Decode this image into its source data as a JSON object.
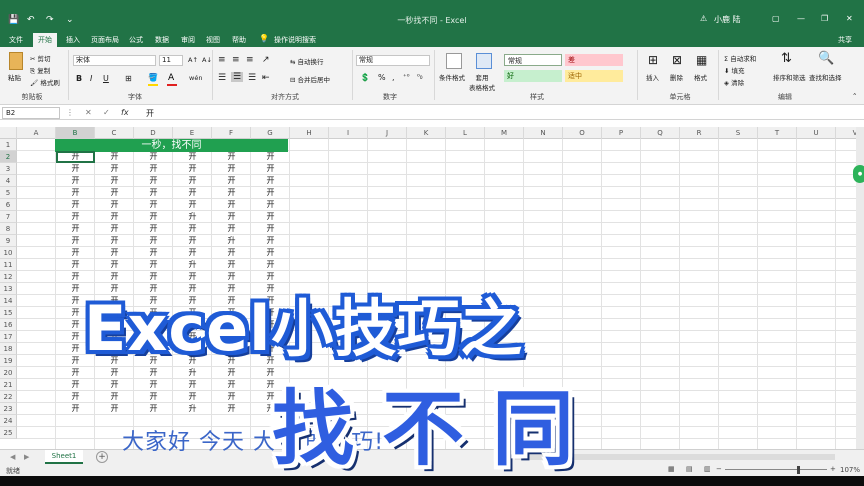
{
  "window": {
    "title": "一秒找不同 - Excel",
    "user": "小鹿 陆",
    "controls": [
      "⚠",
      "▢",
      "—",
      "❐",
      "✕"
    ]
  },
  "quick_access": [
    "💾",
    "↶",
    "↷",
    "⌄"
  ],
  "tabs": [
    "文件",
    "开始",
    "插入",
    "页面布局",
    "公式",
    "数据",
    "审阅",
    "视图",
    "帮助"
  ],
  "tell_me": "操作说明搜索",
  "share": "共享",
  "ribbon": {
    "clipboard": {
      "paste": "粘贴",
      "cut": "剪切",
      "copy": "复制",
      "format_painter": "格式刷",
      "label": "剪贴板"
    },
    "font": {
      "name": "宋体",
      "size": "11",
      "bold": "B",
      "italic": "I",
      "underline": "U",
      "grow": "A↑",
      "shrink": "A↓",
      "wen": "wén",
      "label": "字体"
    },
    "alignment": {
      "wrap": "自动换行",
      "merge": "合并后居中",
      "label": "对齐方式"
    },
    "number": {
      "format": "常规",
      "percent": "%",
      "comma": ",",
      "label": "数字"
    },
    "styles": {
      "cond": "条件格式",
      "table": "套用\n表格格式",
      "cells": [
        {
          "text": "常规",
          "bg": "#ffffff",
          "fg": "#222222"
        },
        {
          "text": "差",
          "bg": "#ffc7ce",
          "fg": "#9c0006"
        },
        {
          "text": "好",
          "bg": "#c6efce",
          "fg": "#006100"
        },
        {
          "text": "适中",
          "bg": "#ffeb9c",
          "fg": "#9c6500"
        }
      ],
      "label": "样式"
    },
    "cells": {
      "insert": "插入",
      "delete": "删除",
      "format": "格式",
      "label": "单元格"
    },
    "editing": {
      "autosum": "自动求和",
      "fill": "填充",
      "clear": "清除",
      "sort": "排序和筛选",
      "find": "查找和选择",
      "label": "编辑"
    }
  },
  "formula_bar": {
    "name_box": "B2",
    "fx": "fx",
    "value": "开"
  },
  "columns": [
    "A",
    "B",
    "C",
    "D",
    "E",
    "F",
    "G",
    "H",
    "I",
    "J",
    "K",
    "L",
    "M",
    "N",
    "O",
    "P",
    "Q",
    "R",
    "S",
    "T",
    "U",
    "V"
  ],
  "rows": [
    "1",
    "2",
    "3",
    "4",
    "5",
    "6",
    "7",
    "8",
    "9",
    "10",
    "11",
    "12",
    "13",
    "14",
    "15",
    "16",
    "17",
    "18",
    "19",
    "20",
    "21",
    "22",
    "23",
    "24",
    "25"
  ],
  "selected_col": "B",
  "selected_row": "2",
  "merged_title": "一秒，找不同",
  "grid_rows": [
    [
      "开",
      "开",
      "开",
      "开",
      "开",
      "开"
    ],
    [
      "开",
      "开",
      "开",
      "开",
      "开",
      "开"
    ],
    [
      "开",
      "开",
      "开",
      "开",
      "开",
      "开"
    ],
    [
      "开",
      "开",
      "开",
      "开",
      "开",
      "开"
    ],
    [
      "开",
      "开",
      "开",
      "开",
      "开",
      "开"
    ],
    [
      "开",
      "开",
      "开",
      "升",
      "开",
      "开"
    ],
    [
      "开",
      "开",
      "开",
      "开",
      "开",
      "开"
    ],
    [
      "开",
      "开",
      "开",
      "开",
      "升",
      "开"
    ],
    [
      "开",
      "开",
      "开",
      "开",
      "开",
      "开"
    ],
    [
      "开",
      "开",
      "开",
      "升",
      "开",
      "开"
    ],
    [
      "开",
      "开",
      "开",
      "开",
      "开",
      "开"
    ],
    [
      "开",
      "开",
      "开",
      "开",
      "开",
      "开"
    ],
    [
      "开",
      "开",
      "开",
      "开",
      "开",
      "开"
    ],
    [
      "开",
      "开",
      "开",
      "开",
      "开",
      "开"
    ],
    [
      "开",
      "开",
      "开",
      "开",
      "开",
      "开"
    ],
    [
      "开",
      "开",
      "开",
      "开",
      "开",
      "开"
    ],
    [
      "开",
      "开",
      "开",
      "开",
      "开",
      "开"
    ],
    [
      "开",
      "开",
      "开",
      "开",
      "开",
      "开"
    ],
    [
      "开",
      "开",
      "开",
      "升",
      "开",
      "开"
    ],
    [
      "开",
      "开",
      "开",
      "开",
      "开",
      "开"
    ],
    [
      "开",
      "开",
      "开",
      "开",
      "开",
      "开"
    ],
    [
      "开",
      "开",
      "开",
      "升",
      "开",
      "开"
    ]
  ],
  "sheet_tab": "Sheet1",
  "status": {
    "ready": "就绪",
    "zoom": "107%"
  },
  "overlay": {
    "title": "Excel小技巧之",
    "subtitle": "大家好 今天    大       L       的技巧!",
    "big": "找不同"
  }
}
